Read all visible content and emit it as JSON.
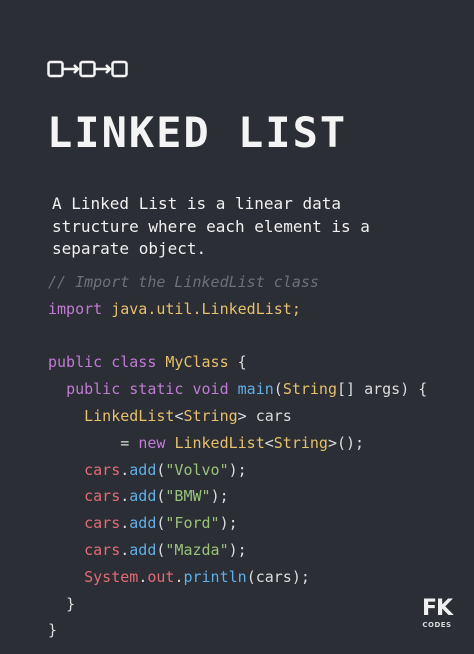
{
  "title": "LINKED LIST",
  "description": {
    "line1": "A Linked List is a linear data",
    "line2": "structure where each element is a",
    "line3": "separate object."
  },
  "code": {
    "comment": "// Import the LinkedList class",
    "import_kw": "import",
    "import_path": "java.util.LinkedList;",
    "l3_public": "public",
    "l3_class": "class",
    "l3_name": "MyClass",
    "l3_brace": " {",
    "l4_public": "public",
    "l4_static": "static",
    "l4_void": "void",
    "l4_main": "main",
    "l4_paren_open": "(",
    "l4_string": "String",
    "l4_rest": "[] args) {",
    "l5_type": "LinkedList",
    "l5_lt": "<",
    "l5_string": "String",
    "l5_gt": ">",
    "l5_var": " cars",
    "l6_eq": "= ",
    "l6_new": "new",
    "l6_type": "LinkedList",
    "l6_lt": "<",
    "l6_string": "String",
    "l6_gt": ">",
    "l6_end": "();",
    "add_obj": "cars",
    "add_dot": ".",
    "add_method": "add",
    "add_open": "(",
    "add_close": ");",
    "strings": [
      "\"Volvo\"",
      "\"BMW\"",
      "\"Ford\"",
      "\"Mazda\""
    ],
    "print_system": "System",
    "print_dot1": ".",
    "print_out": "out",
    "print_dot2": ".",
    "print_method": "println",
    "print_args": "(cars);",
    "close_inner": "}",
    "close_outer": "}"
  },
  "brand": {
    "logo_text": "FK",
    "sub_text": "CODES"
  },
  "icons": {
    "top_icon": "linked-nodes-icon"
  },
  "colors": {
    "background": "#2b2e34",
    "keyword": "#c07bd6",
    "class": "#e6c06b",
    "method": "#5fb0e8",
    "string": "#98c379",
    "comment": "#6c7079"
  }
}
